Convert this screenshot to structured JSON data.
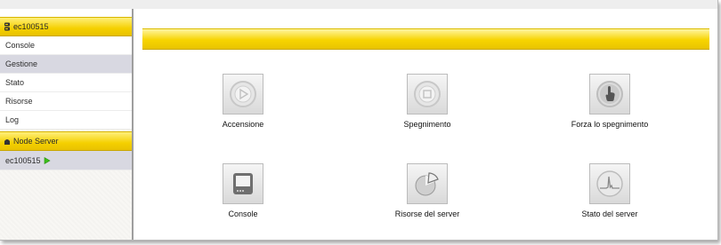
{
  "sidebar": {
    "host_header": "ec100515",
    "items": [
      {
        "label": "Console",
        "active": false
      },
      {
        "label": "Gestione",
        "active": true
      },
      {
        "label": "Stato",
        "active": false
      },
      {
        "label": "Risorse",
        "active": false
      },
      {
        "label": "Log",
        "active": false
      }
    ],
    "node_header": "Node Server",
    "node_item": {
      "label": "ec100515",
      "status_icon": "play-icon",
      "status_color": "#3bbf1a"
    }
  },
  "main": {
    "tiles": [
      {
        "label": "Accensione",
        "icon": "power-on-icon"
      },
      {
        "label": "Spegnimento",
        "icon": "power-off-icon"
      },
      {
        "label": "Forza lo spegnimento",
        "icon": "force-off-hand-icon"
      },
      {
        "label": "Console",
        "icon": "console-monitor-icon"
      },
      {
        "label": "Risorse del server",
        "icon": "resources-pie-icon"
      },
      {
        "label": "Stato del server",
        "icon": "status-graph-icon"
      }
    ]
  },
  "colors": {
    "accent_yellow": "#f5d000",
    "active_item_bg": "#d8d8e1"
  }
}
